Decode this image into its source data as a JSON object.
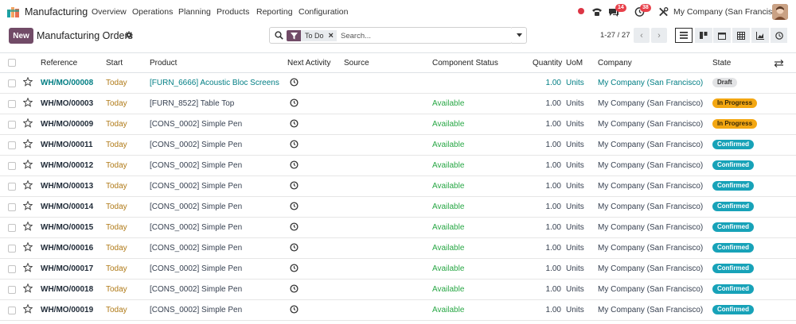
{
  "app": {
    "name": "Manufacturing",
    "menu": [
      "Overview",
      "Operations",
      "Planning",
      "Products",
      "Reporting",
      "Configuration"
    ],
    "messages_badge": "14",
    "activities_badge": "38",
    "company": "My Company (San Francisco)"
  },
  "control": {
    "new_label": "New",
    "title": "Manufacturing Orders",
    "facet": "To Do",
    "search_placeholder": "Search...",
    "pager": "1-27 / 27"
  },
  "table": {
    "headers": {
      "reference": "Reference",
      "start": "Start",
      "product": "Product",
      "next_activity": "Next Activity",
      "source": "Source",
      "component_status": "Component Status",
      "quantity": "Quantity",
      "uom": "UoM",
      "company": "Company",
      "state": "State"
    },
    "rows": [
      {
        "ref": "WH/MO/00008",
        "start": "Today",
        "product": "[FURN_6666] Acoustic Bloc Screens",
        "component_status": "",
        "qty": "1.00",
        "uom": "Units",
        "company": "My Company (San Francisco)",
        "state": "Draft",
        "kind": "draft"
      },
      {
        "ref": "WH/MO/00003",
        "start": "Today",
        "product": "[FURN_8522] Table Top",
        "component_status": "Available",
        "qty": "1.00",
        "uom": "Units",
        "company": "My Company (San Francisco)",
        "state": "In Progress",
        "kind": "progress"
      },
      {
        "ref": "WH/MO/00009",
        "start": "Today",
        "product": "[CONS_0002] Simple Pen",
        "component_status": "Available",
        "qty": "1.00",
        "uom": "Units",
        "company": "My Company (San Francisco)",
        "state": "In Progress",
        "kind": "progress"
      },
      {
        "ref": "WH/MO/00011",
        "start": "Today",
        "product": "[CONS_0002] Simple Pen",
        "component_status": "Available",
        "qty": "1.00",
        "uom": "Units",
        "company": "My Company (San Francisco)",
        "state": "Confirmed",
        "kind": "confirmed"
      },
      {
        "ref": "WH/MO/00012",
        "start": "Today",
        "product": "[CONS_0002] Simple Pen",
        "component_status": "Available",
        "qty": "1.00",
        "uom": "Units",
        "company": "My Company (San Francisco)",
        "state": "Confirmed",
        "kind": "confirmed"
      },
      {
        "ref": "WH/MO/00013",
        "start": "Today",
        "product": "[CONS_0002] Simple Pen",
        "component_status": "Available",
        "qty": "1.00",
        "uom": "Units",
        "company": "My Company (San Francisco)",
        "state": "Confirmed",
        "kind": "confirmed"
      },
      {
        "ref": "WH/MO/00014",
        "start": "Today",
        "product": "[CONS_0002] Simple Pen",
        "component_status": "Available",
        "qty": "1.00",
        "uom": "Units",
        "company": "My Company (San Francisco)",
        "state": "Confirmed",
        "kind": "confirmed"
      },
      {
        "ref": "WH/MO/00015",
        "start": "Today",
        "product": "[CONS_0002] Simple Pen",
        "component_status": "Available",
        "qty": "1.00",
        "uom": "Units",
        "company": "My Company (San Francisco)",
        "state": "Confirmed",
        "kind": "confirmed"
      },
      {
        "ref": "WH/MO/00016",
        "start": "Today",
        "product": "[CONS_0002] Simple Pen",
        "component_status": "Available",
        "qty": "1.00",
        "uom": "Units",
        "company": "My Company (San Francisco)",
        "state": "Confirmed",
        "kind": "confirmed"
      },
      {
        "ref": "WH/MO/00017",
        "start": "Today",
        "product": "[CONS_0002] Simple Pen",
        "component_status": "Available",
        "qty": "1.00",
        "uom": "Units",
        "company": "My Company (San Francisco)",
        "state": "Confirmed",
        "kind": "confirmed"
      },
      {
        "ref": "WH/MO/00018",
        "start": "Today",
        "product": "[CONS_0002] Simple Pen",
        "component_status": "Available",
        "qty": "1.00",
        "uom": "Units",
        "company": "My Company (San Francisco)",
        "state": "Confirmed",
        "kind": "confirmed"
      },
      {
        "ref": "WH/MO/00019",
        "start": "Today",
        "product": "[CONS_0002] Simple Pen",
        "component_status": "Available",
        "qty": "1.00",
        "uom": "Units",
        "company": "My Company (San Francisco)",
        "state": "Confirmed",
        "kind": "confirmed"
      }
    ]
  },
  "colors": {
    "brand": "#714b67",
    "link": "#017e84",
    "today": "#b07a17",
    "available": "#28a745",
    "in_progress": "#f3a712",
    "confirmed": "#17a2b8",
    "draft": "#e2e3e5"
  },
  "icons": [
    "app-logo-icon",
    "phone-icon",
    "chat-icon",
    "activity-clock-icon",
    "debug-tools-icon",
    "gear-icon",
    "search-icon",
    "filter-icon",
    "caret-down-icon",
    "chevron-left-icon",
    "chevron-right-icon",
    "list-view-icon",
    "kanban-view-icon",
    "calendar-view-icon",
    "pivot-view-icon",
    "graph-view-icon",
    "activity-view-icon",
    "star-icon",
    "optional-columns-icon"
  ]
}
